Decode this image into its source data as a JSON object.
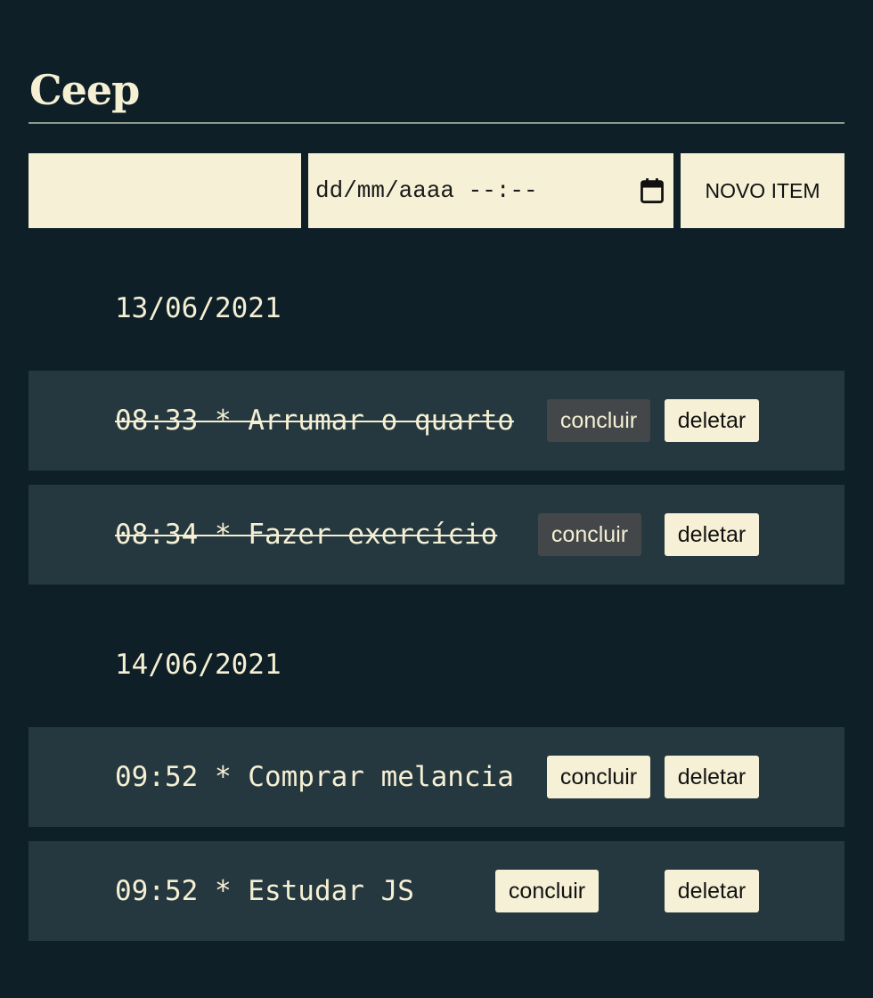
{
  "app": {
    "title": "Ceep"
  },
  "form": {
    "text_value": "",
    "date_placeholder": "dd/mm/aaaa --:--",
    "new_item_label": "NOVO ITEM"
  },
  "groups": [
    {
      "date": "13/06/2021",
      "tasks": [
        {
          "text": "08:33 * Arrumar o quarto",
          "done": true,
          "conclude_label": "concluir",
          "delete_label": "deletar"
        },
        {
          "text": "08:34 * Fazer exercício",
          "done": true,
          "conclude_label": "concluir",
          "delete_label": "deletar"
        }
      ]
    },
    {
      "date": "14/06/2021",
      "tasks": [
        {
          "text": "09:52 * Comprar melancia",
          "done": false,
          "conclude_label": "concluir",
          "delete_label": "deletar"
        },
        {
          "text": "09:52 * Estudar JS",
          "done": false,
          "conclude_label": "concluir",
          "delete_label": "deletar"
        }
      ]
    }
  ],
  "colors": {
    "background": "#0e1f27",
    "row": "#25373f",
    "cream": "#f6f1d6",
    "disabled_button": "#444749"
  }
}
